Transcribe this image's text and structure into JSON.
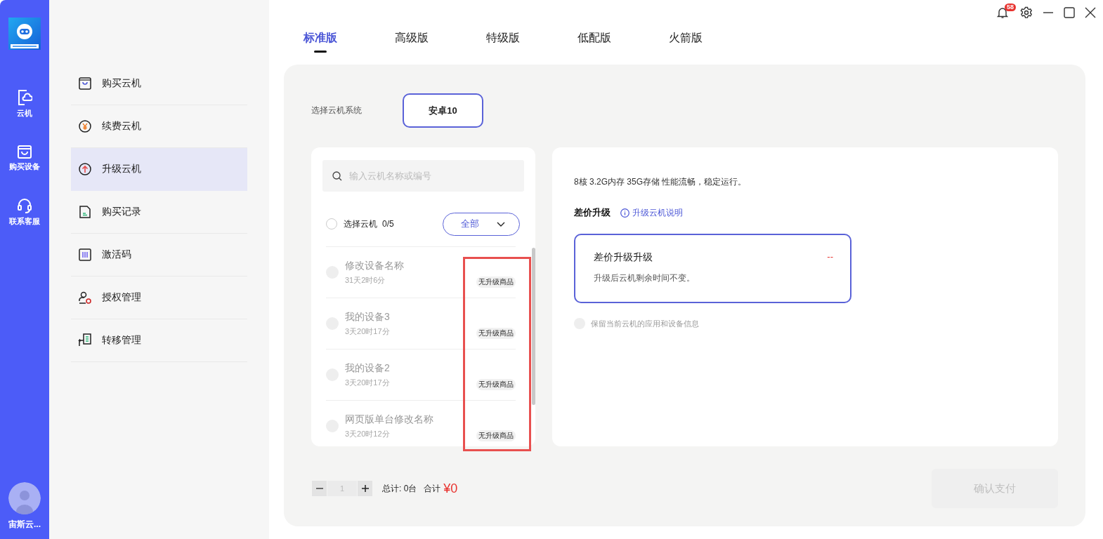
{
  "rail": {
    "items": [
      {
        "label": "云机",
        "kind": "cloud-phone"
      },
      {
        "label": "购买设备",
        "kind": "bag"
      },
      {
        "label": "联系客服",
        "kind": "headset"
      }
    ],
    "user": "宙斯云..."
  },
  "notifications": {
    "count": "58"
  },
  "nav": [
    {
      "label": "购买云机",
      "kind": "bag",
      "selected": false
    },
    {
      "label": "续费云机",
      "kind": "yuan",
      "selected": false
    },
    {
      "label": "升级云机",
      "kind": "up",
      "selected": true
    },
    {
      "label": "购买记录",
      "kind": "doc",
      "selected": false
    },
    {
      "label": "激活码",
      "kind": "bars",
      "selected": false
    },
    {
      "label": "授权管理",
      "kind": "user",
      "selected": false
    },
    {
      "label": "转移管理",
      "kind": "transfer",
      "selected": false
    }
  ],
  "tabs": [
    {
      "label": "标准版",
      "selected": true
    },
    {
      "label": "高级版",
      "selected": false
    },
    {
      "label": "特级版",
      "selected": false
    },
    {
      "label": "低配版",
      "selected": false
    },
    {
      "label": "火箭版",
      "selected": false
    }
  ],
  "system": {
    "label": "选择云机系统",
    "options": [
      {
        "label": "安卓10",
        "selected": true
      }
    ]
  },
  "device_list": {
    "search_placeholder": "输入云机名称或编号",
    "select_all": {
      "label": "选择云机",
      "count": "0/5",
      "checked": false
    },
    "filter": "全部",
    "highlight_badges": true,
    "devices": [
      {
        "name": "修改设备名称",
        "time": "31天2时6分",
        "badge": "无升级商品",
        "disabled": true
      },
      {
        "name": "我的设备3",
        "time": "3天20时17分",
        "badge": "无升级商品",
        "disabled": true
      },
      {
        "name": "我的设备2",
        "time": "3天20时17分",
        "badge": "无升级商品",
        "disabled": true
      },
      {
        "name": "网页版单台修改名称",
        "time": "3天20时12分",
        "badge": "无升级商品",
        "disabled": true
      }
    ]
  },
  "detail": {
    "spec": "8核 3.2G内存 35G存储 性能流畅，稳定运行。",
    "section": "差价升级",
    "help_link": "升级云机说明",
    "option": {
      "title": "差价升级升级",
      "price": "--",
      "note": "升级后云机剩余时间不变。",
      "selected": true
    },
    "keep_data": {
      "label": "保留当前云机的应用和设备信息",
      "checked": false
    }
  },
  "footer": {
    "quantity": "1",
    "total": "总计: 0台",
    "sum_label": "合计",
    "sum": "¥0",
    "confirm": {
      "label": "确认支付",
      "disabled": true
    }
  }
}
